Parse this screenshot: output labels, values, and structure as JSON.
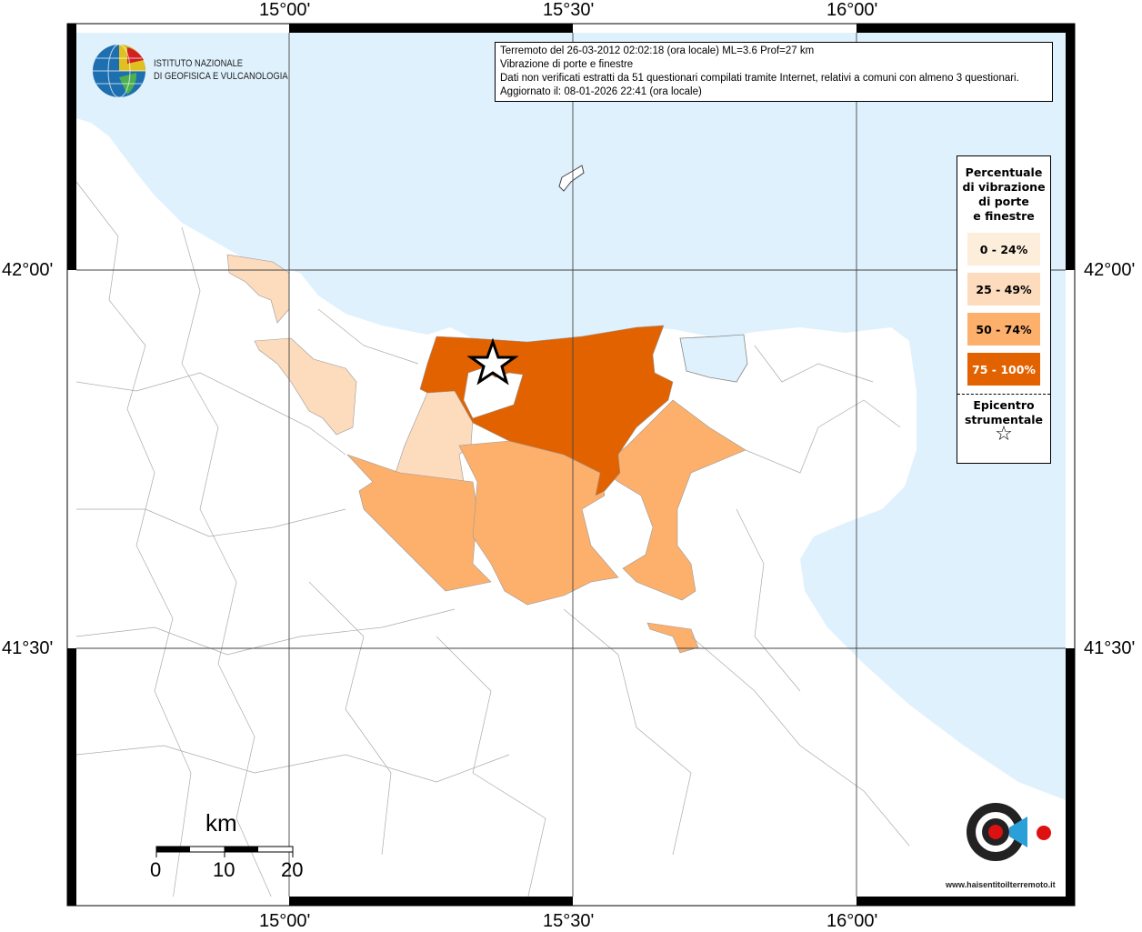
{
  "header": {
    "lines": [
      "Terremoto del 26-03-2012 02:02:18 (ora locale) ML=3.6 Prof=27 km",
      "Vibrazione di porte e finestre",
      "Dati non verificati estratti da 51 questionari compilati tramite Internet, relativi a comuni con almeno 3 questionari.",
      "Aggiornato il: 08-01-2026 22:41 (ora locale)"
    ]
  },
  "logo": {
    "line1": "ISTITUTO NAZIONALE",
    "line2": "DI GEOFISICA E VULCANOLOGIA"
  },
  "axes": {
    "lon_ticks": [
      "15°00'",
      "15°30'",
      "16°00'"
    ],
    "lat_ticks": [
      "42°00'",
      "41°30'"
    ]
  },
  "legend": {
    "title_lines": [
      "Percentuale",
      "di vibrazione",
      "di porte",
      "e finestre"
    ],
    "classes": [
      {
        "label": "0 - 24%",
        "color": "#fdeedb",
        "text_color": "#000000"
      },
      {
        "label": "25 - 49%",
        "color": "#fddbbd",
        "text_color": "#000000"
      },
      {
        "label": "50 - 74%",
        "color": "#fdb06c",
        "text_color": "#000000"
      },
      {
        "label": "75 - 100%",
        "color": "#e26200",
        "text_color": "#ffffff"
      }
    ],
    "epicenter_lines": [
      "Epicentro",
      "strumentale"
    ],
    "epicenter_symbol": "☆"
  },
  "scale": {
    "unit": "km",
    "labels": [
      "0",
      "10",
      "20"
    ]
  },
  "badge": {
    "text": "www.haisentitoilterremoto.it"
  },
  "colors": {
    "sea": "#dff1fd",
    "land": "#ffffff",
    "border": "#aaaaaa"
  }
}
